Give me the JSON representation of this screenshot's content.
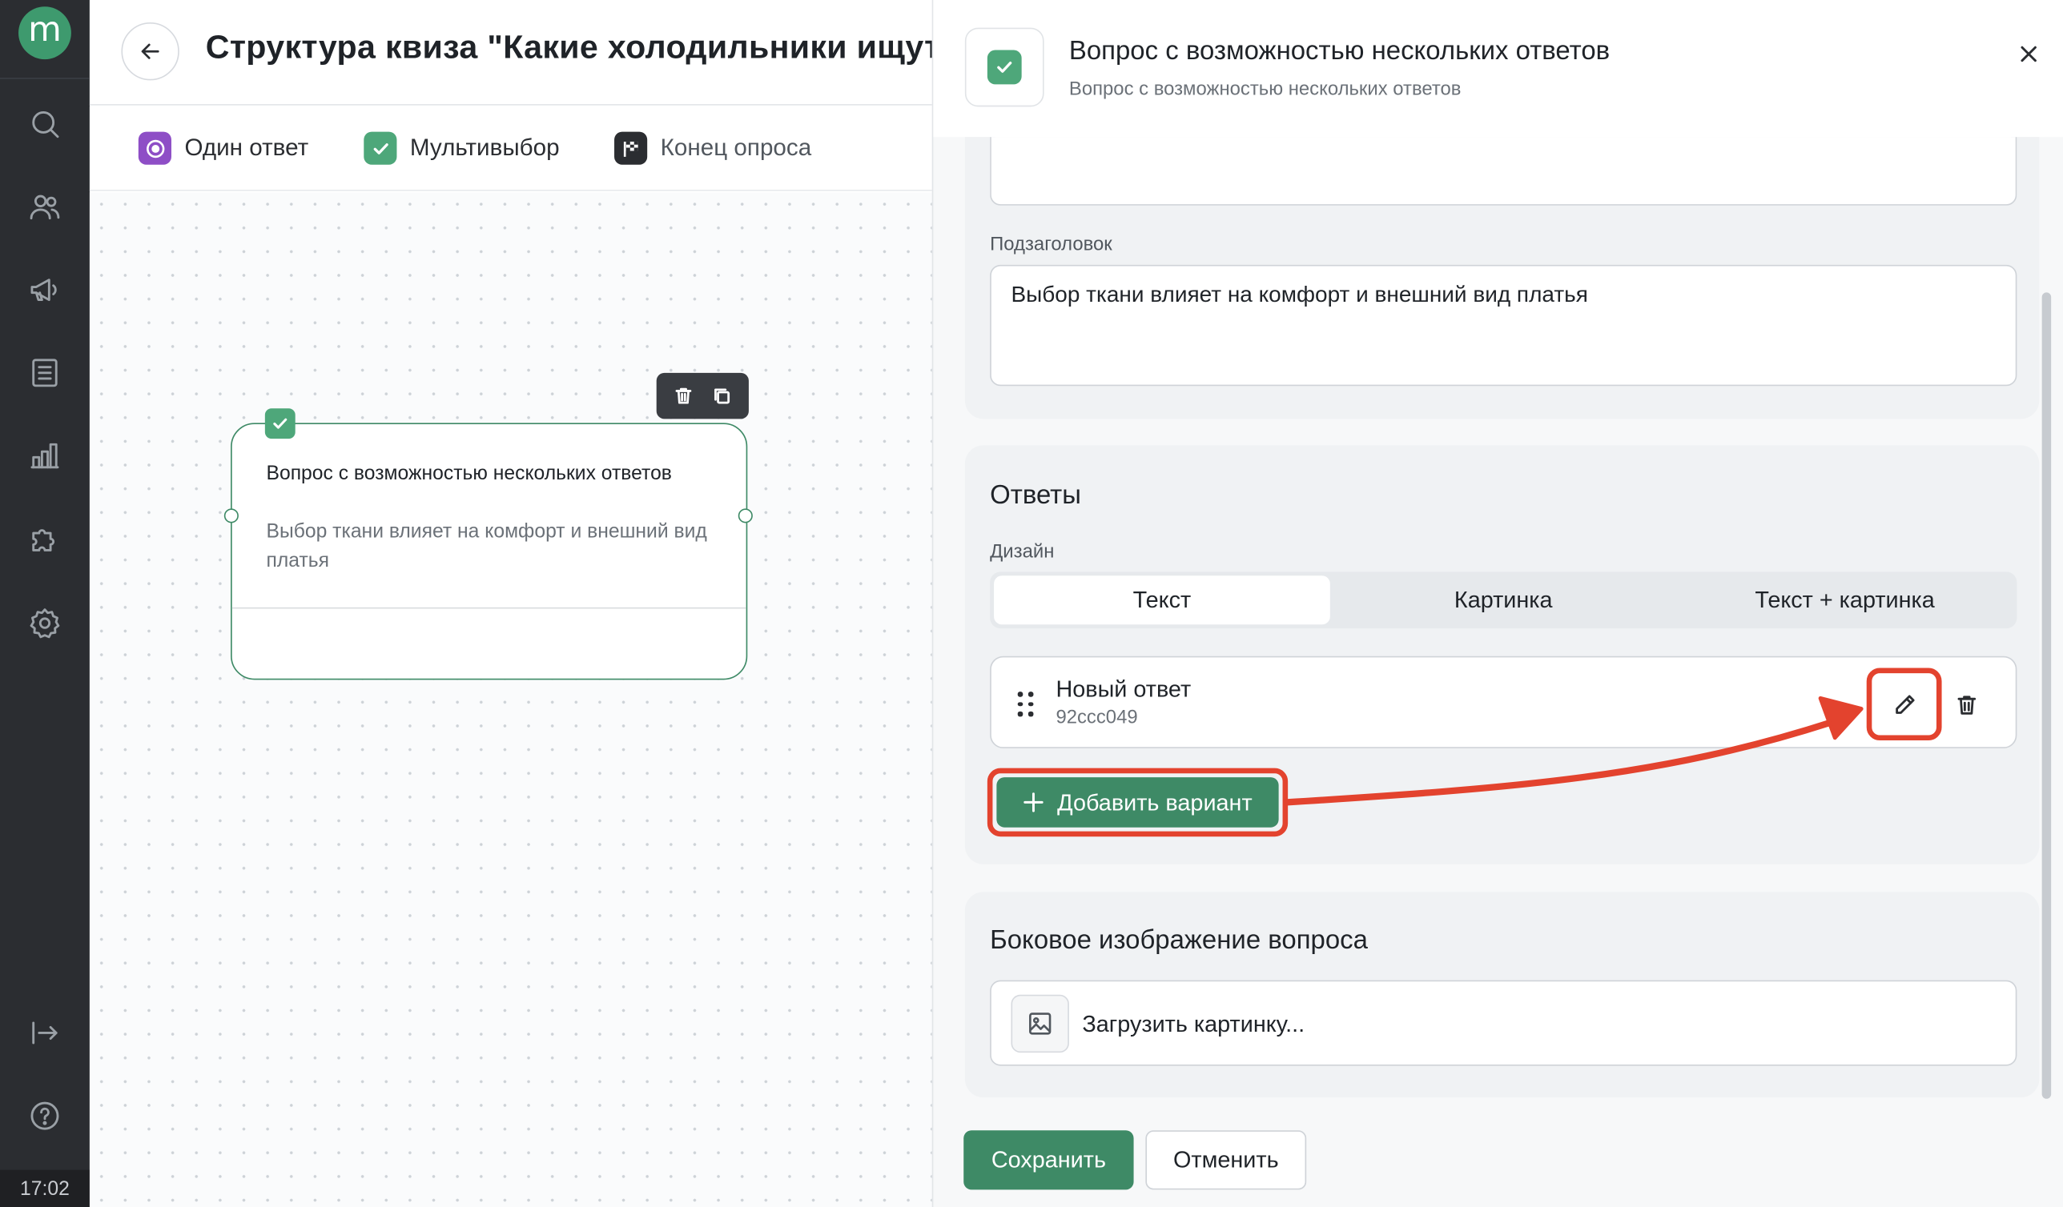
{
  "app": {
    "logo": "m",
    "time": "17:02"
  },
  "sidebar": {
    "items": [
      {
        "icon": "search-icon"
      },
      {
        "icon": "users-icon"
      },
      {
        "icon": "megaphone-icon"
      },
      {
        "icon": "document-icon"
      },
      {
        "icon": "bar-chart-icon"
      },
      {
        "icon": "puzzle-icon"
      },
      {
        "icon": "gear-icon"
      },
      {
        "icon": "logout-icon"
      },
      {
        "icon": "help-icon"
      }
    ]
  },
  "header": {
    "title": "Структура квиза \"Какие холодильники ищут вы"
  },
  "toolbar": {
    "items": [
      {
        "label": "Один ответ",
        "icon": "radio-icon",
        "color": "#8e4ec6"
      },
      {
        "label": "Мультивыбор",
        "icon": "checkbox-icon",
        "color": "#4ea77a"
      },
      {
        "label": "Конец опроса",
        "icon": "flag-icon",
        "color": "#2b2d31"
      }
    ]
  },
  "node": {
    "title": "Вопрос с возможностью нескольких ответов",
    "subtitle": "Выбор ткани влияет на комфорт и внешний вид платья"
  },
  "panel": {
    "title": "Вопрос с возможностью нескольких ответов",
    "subtitle": "Вопрос с возможностью нескольких ответов",
    "subheading_label": "Подзаголовок",
    "subheading_value": "Выбор ткани влияет на комфорт и внешний вид платья",
    "answers_title": "Ответы",
    "design_label": "Дизайн",
    "design_options": [
      "Текст",
      "Картинка",
      "Текст + картинка"
    ],
    "design_selected": "Текст",
    "answer": {
      "title": "Новый ответ",
      "id": "92ccc049"
    },
    "add_variant": "Добавить вариант",
    "side_image_title": "Боковое изображение вопроса",
    "upload_label": "Загрузить картинку...",
    "save": "Сохранить",
    "cancel": "Отменить"
  },
  "colors": {
    "accent": "#3e8a66",
    "highlight": "#e3432e",
    "sidebar": "#2b2d31"
  }
}
